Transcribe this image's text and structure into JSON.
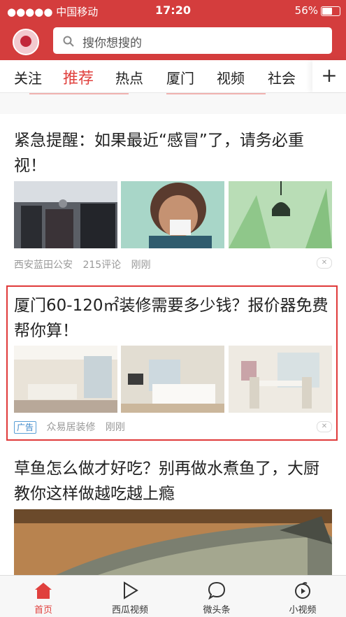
{
  "status_bar": {
    "carrier": "●●●●● 中国移动",
    "time": "17:20",
    "battery": "56%"
  },
  "search": {
    "placeholder": "搜你想搜的"
  },
  "tabs": [
    "关注",
    "推荐",
    "热点",
    "厦门",
    "视频",
    "社会"
  ],
  "articles": [
    {
      "title": "紧急提醒：如果最近“感冒”了，请务必重视！",
      "source": "西安蓝田公安",
      "comments": "215评论",
      "time": "刚刚"
    },
    {
      "title": "厦门60-120㎡装修需要多少钱？报价器免费帮你算！",
      "ad_label": "广告",
      "source": "众易居装修",
      "time": "刚刚"
    },
    {
      "title": "草鱼怎么做才好吃？别再做水煮鱼了，大厨教你这样做越吃越上瘾"
    }
  ],
  "bottom_nav": [
    "首页",
    "西瓜视频",
    "微头条",
    "小视频"
  ],
  "colors": {
    "brand": "#d43d3d",
    "active": "#e0403d",
    "ad_border": "#e03a3a"
  }
}
